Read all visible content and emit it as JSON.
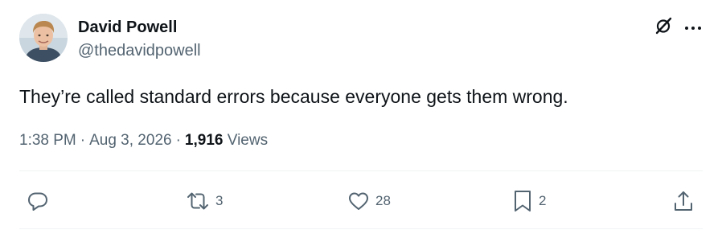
{
  "author": {
    "display_name": "David Powell",
    "handle": "@thedavidpowell"
  },
  "tweet": {
    "text": "They’re called standard errors because everyone gets them wrong.",
    "time": "1:38 PM",
    "separator": "·",
    "date": "Aug 3, 2026",
    "views_count": "1,916",
    "views_label": "Views"
  },
  "actions": {
    "replies": "",
    "retweets": "3",
    "likes": "28",
    "bookmarks": "2"
  },
  "icons": {
    "top": [
      "grok-icon",
      "more-icon"
    ],
    "actions": [
      "reply-icon",
      "retweet-icon",
      "like-icon",
      "bookmark-icon",
      "share-icon"
    ]
  },
  "colors": {
    "text": "#0f1419",
    "secondary": "#536471",
    "divider": "#eff3f4"
  }
}
